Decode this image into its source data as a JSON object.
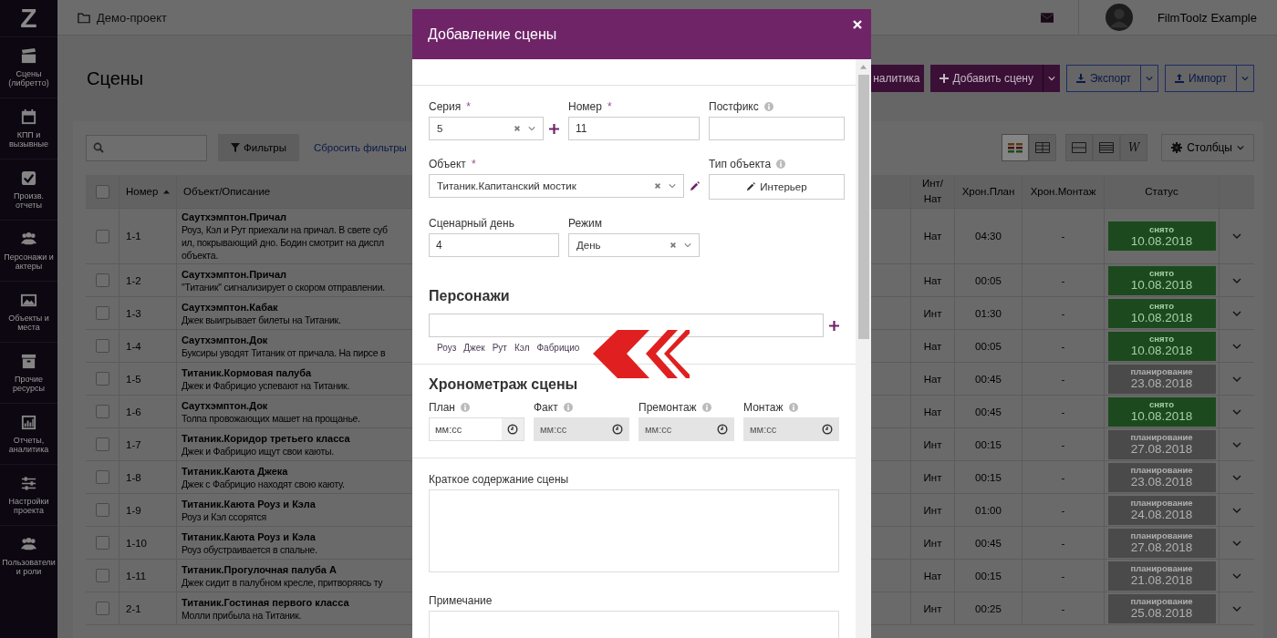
{
  "sidebar": {
    "logo": "Z",
    "items": [
      {
        "label": "Сцены (либретто)",
        "kind": "clapperboard"
      },
      {
        "label": "КПП и вызывные",
        "kind": "calendar"
      },
      {
        "label": "Произв. отчеты",
        "kind": "checkbox"
      },
      {
        "label": "Персонажи и актеры",
        "kind": "people"
      },
      {
        "label": "Объекты и места",
        "kind": "picture"
      },
      {
        "label": "Прочие ресурсы",
        "kind": "archive"
      },
      {
        "label": "Отчеты, аналитика",
        "kind": "chart"
      },
      {
        "label": "Настройки проекта",
        "kind": "sliders"
      },
      {
        "label": "Пользователи и роли",
        "kind": "people"
      }
    ]
  },
  "topbar": {
    "project": "Демо-проект",
    "user": "FilmToolz Example"
  },
  "page": {
    "title": "Сцены",
    "actions": [
      {
        "label": "налитика",
        "kind": "analytics",
        "split": false
      },
      {
        "label": "Добавить сцену",
        "kind": "add",
        "split": true
      },
      {
        "label": "Экспорт",
        "kind": "export",
        "split": true
      },
      {
        "label": "Импорт",
        "kind": "import",
        "split": true
      }
    ]
  },
  "toolbar": {
    "filters": "Фильтры",
    "reset": "Сбросить фильтры",
    "view_modes": [
      {
        "kind": "colors",
        "selected": true
      },
      {
        "kind": "grid",
        "selected": false
      }
    ],
    "densities": [
      {
        "kind": "normal",
        "selected": false
      },
      {
        "kind": "compact",
        "selected": false
      },
      {
        "kind": "wrap",
        "label": "W",
        "selected": false
      }
    ],
    "columns": "Столбцы"
  },
  "table": {
    "select_all_checked": false,
    "columns": [
      "Номер",
      "Объект/Описание",
      "Инт/Нат",
      "Хрон.План",
      "Хрон.Монтаж",
      "Статус"
    ],
    "rows": [
      {
        "checked": false,
        "number": "1-1",
        "object": "Саутхэмптон.Причал",
        "description": [
          "Роуз, Кэл и Рут приехали на причал. В свете суб",
          "ил, покрывающий дно. Бодин смотрит на диспл",
          "объекта."
        ],
        "int_nat": "Нат",
        "plan": "04:30",
        "montage": "-",
        "status": {
          "kind": "shot",
          "label": "снято",
          "date": "10.08.2018"
        }
      },
      {
        "checked": false,
        "number": "1-2",
        "object": "Саутхэмптон.Причал",
        "description": [
          "\"Титаник\" сигнализирует о скором отправлении."
        ],
        "int_nat": "Нат",
        "plan": "00:05",
        "montage": "-",
        "status": {
          "kind": "shot",
          "label": "снято",
          "date": "10.08.2018"
        }
      },
      {
        "checked": false,
        "number": "1-3",
        "object": "Саутхэмптон.Кабак",
        "description": [
          "Джек выигрывает билеты на Титаник."
        ],
        "int_nat": "Инт",
        "plan": "01:30",
        "montage": "-",
        "status": {
          "kind": "shot",
          "label": "снято",
          "date": "10.08.2018"
        }
      },
      {
        "checked": false,
        "number": "1-4",
        "object": "Саутхэмптон.Док",
        "description": [
          "Буксиры уводят Титаник от причала. На пирсе в"
        ],
        "int_nat": "Нат",
        "plan": "00:05",
        "montage": "-",
        "status": {
          "kind": "shot",
          "label": "снято",
          "date": "10.08.2018"
        }
      },
      {
        "checked": false,
        "number": "1-5",
        "object": "Титаник.Кормовая палуба",
        "description": [
          "Джек и Фабрицио успевают на Титаник."
        ],
        "int_nat": "Нат",
        "plan": "00:45",
        "montage": "-",
        "status": {
          "kind": "planning",
          "label": "планирование",
          "date": "23.08.2018"
        }
      },
      {
        "checked": false,
        "number": "1-6",
        "object": "Саутхэмптон.Док",
        "description": [
          "Толпа провожающих машет на прощанье."
        ],
        "int_nat": "Нат",
        "plan": "00:45",
        "montage": "-",
        "status": {
          "kind": "shot",
          "label": "снято",
          "date": "10.08.2018"
        }
      },
      {
        "checked": false,
        "number": "1-7",
        "object": "Титаник.Коридор третьего класса",
        "description": [
          "Джек и Фабрицио ищут свои каюты."
        ],
        "int_nat": "Инт",
        "plan": "00:15",
        "montage": "-",
        "status": {
          "kind": "planning",
          "label": "планирование",
          "date": "27.08.2018"
        }
      },
      {
        "checked": false,
        "number": "1-8",
        "object": "Титаник.Каюта Джека",
        "description": [
          "Джек с Фабрицио находят свою каюту."
        ],
        "int_nat": "Инт",
        "plan": "00:15",
        "montage": "-",
        "status": {
          "kind": "planning",
          "label": "планирование",
          "date": "23.08.2018"
        }
      },
      {
        "checked": false,
        "number": "1-9",
        "object": "Титаник.Каюта Роуз и Кэла",
        "description": [
          "Роуз и Кэл ссорятся"
        ],
        "int_nat": "Инт",
        "plan": "01:00",
        "montage": "-",
        "status": {
          "kind": "planning",
          "label": "планирование",
          "date": "24.08.2018"
        }
      },
      {
        "checked": false,
        "number": "1-10",
        "object": "Титаник.Каюта Роуз и Кэла",
        "description": [
          "Роуз обустраивается в спальне."
        ],
        "int_nat": "Инт",
        "plan": "00:45",
        "montage": "-",
        "status": {
          "kind": "planning",
          "label": "планирование",
          "date": "27.08.2018"
        }
      },
      {
        "checked": false,
        "number": "1-11",
        "object": "Титаник.Прогулочная палуба А",
        "description": [
          "Джек сидит в палубном кресле, притворяясь ту"
        ],
        "int_nat": "Нат",
        "plan": "00:15",
        "montage": "-",
        "status": {
          "kind": "planning",
          "label": "планирование",
          "date": "21.08.2018"
        }
      },
      {
        "checked": false,
        "number": "2-1",
        "object": "Титаник.Гостиная первого класса",
        "description": [
          "Молли прибыла на Титаник."
        ],
        "int_nat": "Инт",
        "plan": "00:25",
        "montage": "-",
        "status": {
          "kind": "planning",
          "label": "планирование",
          "date": "25.08.2018"
        }
      }
    ]
  },
  "modal": {
    "title": "Добавление сцены",
    "series": {
      "label": "Серия",
      "required_mark": "*",
      "value": "5"
    },
    "number": {
      "label": "Номер",
      "required_mark": "*",
      "value": "11"
    },
    "postfix": {
      "label": "Постфикс",
      "info": true
    },
    "object": {
      "label": "Объект",
      "required_mark": "*",
      "value": "Титаник.Капитанский мостик"
    },
    "object_type": {
      "label": "Тип объекта",
      "info": true,
      "value": "Интерьер"
    },
    "script_day": {
      "label": "Сценарный день",
      "value": "4"
    },
    "mode": {
      "label": "Режим",
      "value": "День"
    },
    "characters": {
      "heading": "Персонажи",
      "suggestions": [
        "Роуз",
        "Джек",
        "Рут",
        "Кэл",
        "Фабрицио"
      ]
    },
    "timing": {
      "heading": "Хронометраж сцены",
      "fields": [
        {
          "label": "План",
          "info": true,
          "placeholder": "мм:сс",
          "disabled": false
        },
        {
          "label": "Факт",
          "info": true,
          "placeholder": "мм:сс",
          "disabled": true
        },
        {
          "label": "Премонтаж",
          "info": true,
          "placeholder": "мм:сс",
          "disabled": true
        },
        {
          "label": "Монтаж",
          "info": true,
          "placeholder": "мм:сс",
          "disabled": true
        }
      ]
    },
    "summary": {
      "label": "Краткое содержание сцены"
    },
    "note": {
      "label": "Примечание"
    }
  }
}
